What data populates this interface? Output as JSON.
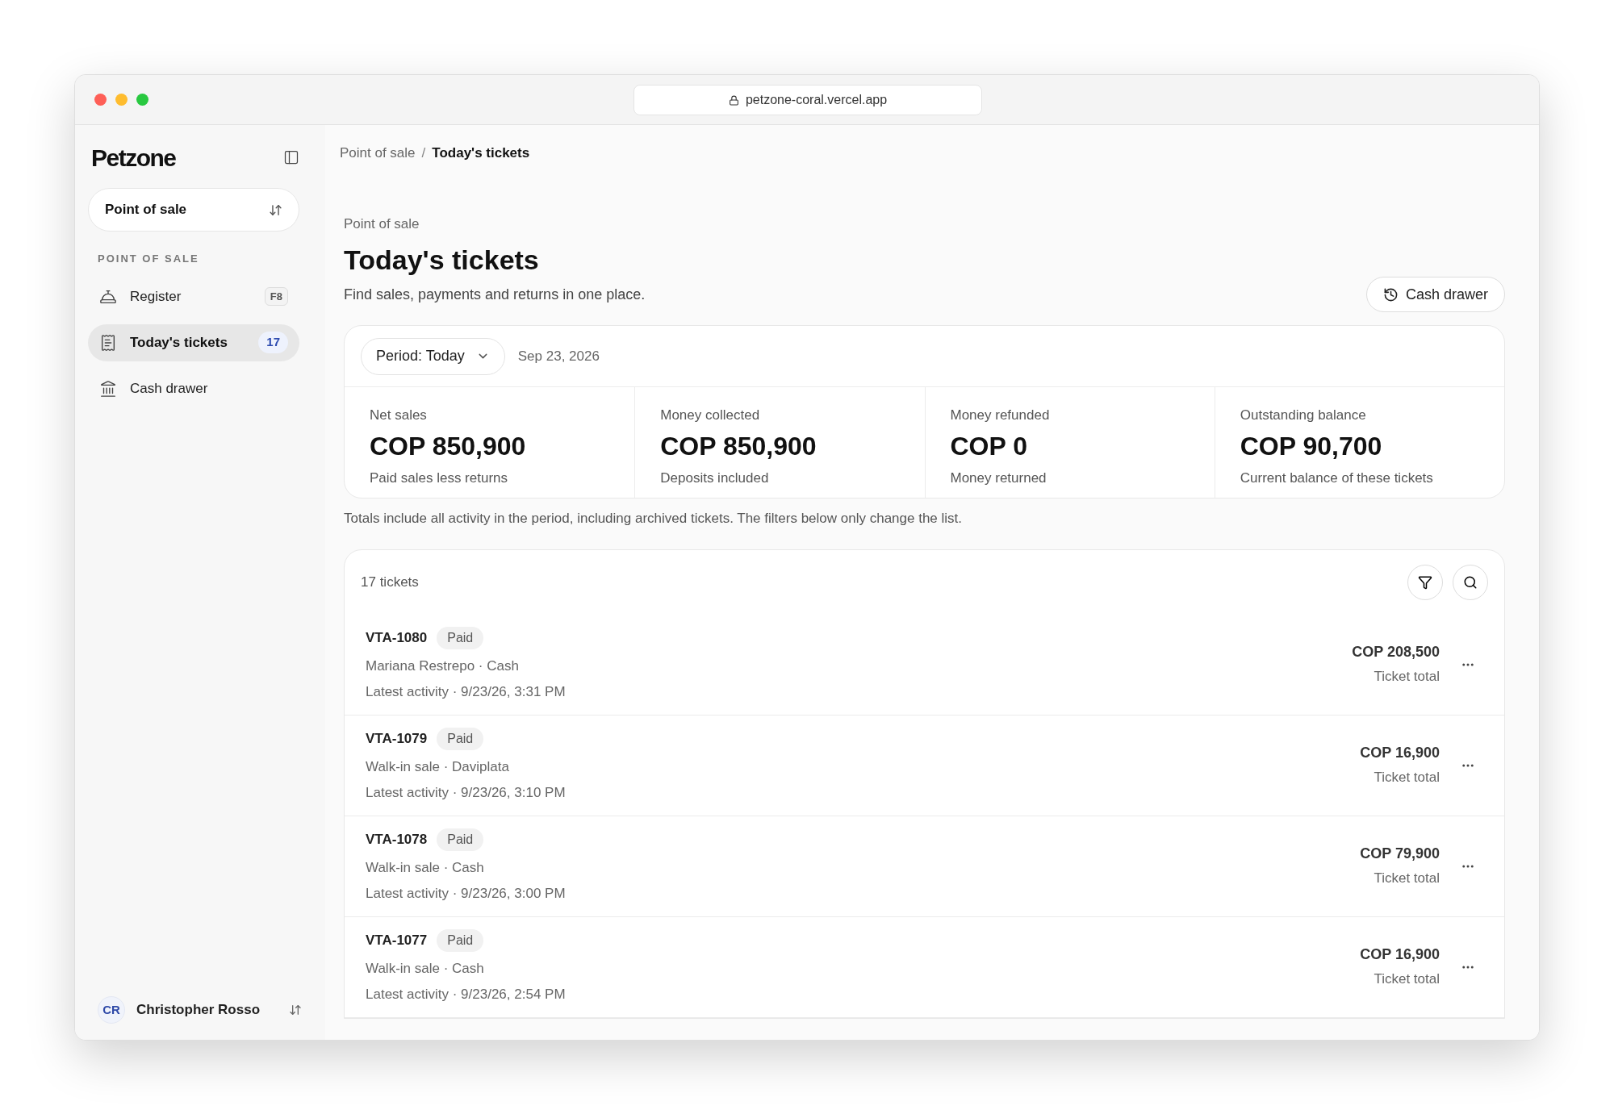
{
  "browser": {
    "url": "petzone-coral.vercel.app"
  },
  "sidebar": {
    "brand": "Petzone",
    "switcher": {
      "label": "Point of sale"
    },
    "section_label": "POINT OF SALE",
    "items": [
      {
        "label": "Register",
        "shortcut": "F8",
        "selected": false
      },
      {
        "label": "Today's tickets",
        "badge": "17",
        "selected": true
      },
      {
        "label": "Cash drawer",
        "selected": false
      }
    ],
    "user": {
      "initials": "CR",
      "name": "Christopher Rosso"
    }
  },
  "breadcrumb": {
    "separator": "/",
    "items": [
      {
        "label": "Point of sale",
        "current": false
      },
      {
        "label": "Today's tickets",
        "current": true
      }
    ]
  },
  "header": {
    "eyebrow": "Point of sale",
    "title": "Today's tickets",
    "subtitle": "Find sales, payments and returns in one place.",
    "action": "Cash drawer"
  },
  "summary": {
    "period": "Period: Today",
    "date": "Sep 23, 2026",
    "stats": [
      {
        "label": "Net sales",
        "value": "COP 850,900",
        "note": "Paid sales less returns"
      },
      {
        "label": "Money collected",
        "value": "COP 850,900",
        "note": "Deposits included"
      },
      {
        "label": "Money refunded",
        "value": "COP 0",
        "note": "Money returned"
      },
      {
        "label": "Outstanding balance",
        "value": "COP 90,700",
        "note": "Current balance of these tickets"
      }
    ],
    "footnote": "Totals include all activity in the period, including archived tickets. The filters below only change the list."
  },
  "tickets": {
    "count": "17 tickets",
    "rows": [
      {
        "id": "VTA-1080",
        "status": "Paid",
        "customer": "Mariana Restrepo · Cash",
        "activity": "Latest activity · 9/23/26, 3:31 PM",
        "total": "COP 208,500",
        "total_label": "Ticket total"
      },
      {
        "id": "VTA-1079",
        "status": "Paid",
        "customer": "Walk-in sale · Daviplata",
        "activity": "Latest activity · 9/23/26, 3:10 PM",
        "total": "COP 16,900",
        "total_label": "Ticket total"
      },
      {
        "id": "VTA-1078",
        "status": "Paid",
        "customer": "Walk-in sale · Cash",
        "activity": "Latest activity · 9/23/26, 3:00 PM",
        "total": "COP 79,900",
        "total_label": "Ticket total"
      },
      {
        "id": "VTA-1077",
        "status": "Paid",
        "customer": "Walk-in sale · Cash",
        "activity": "Latest activity · 9/23/26, 2:54 PM",
        "total": "COP 16,900",
        "total_label": "Ticket total"
      }
    ]
  }
}
